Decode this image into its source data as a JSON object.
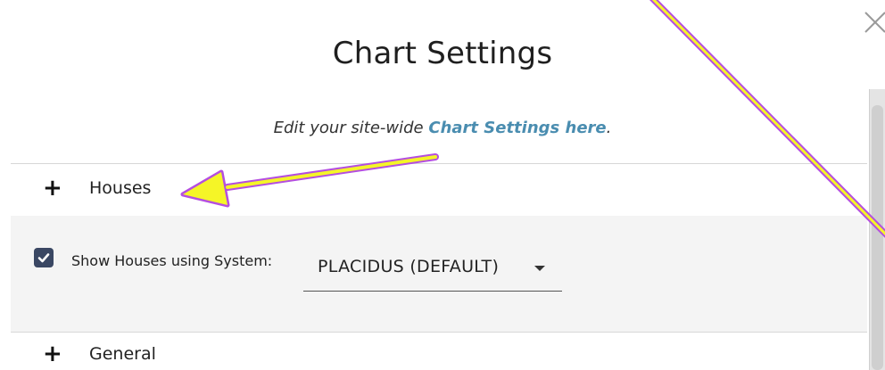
{
  "dialog": {
    "title": "Chart Settings",
    "subtitle_prefix": "Edit your site-wide ",
    "subtitle_link": "Chart Settings here",
    "subtitle_suffix": "."
  },
  "sections": [
    {
      "expand_symbol": "+",
      "label": "Houses"
    },
    {
      "expand_symbol": "+",
      "label": "General"
    }
  ],
  "houses_panel": {
    "checkbox_checked": true,
    "checkbox_label": "Show Houses using System:",
    "system_select_value": "PLACIDUS (DEFAULT)"
  },
  "icons": {
    "close": "close-icon",
    "checkbox": "checkmark-icon",
    "dropdown": "caret-down-icon",
    "expand": "plus-icon"
  },
  "colors": {
    "link": "#4a8db0",
    "checkbox": "#3a4763",
    "panel_background": "#f4f4f4",
    "annotation_arrow": "#f5f527",
    "annotation_outline": "#b44ee0"
  }
}
